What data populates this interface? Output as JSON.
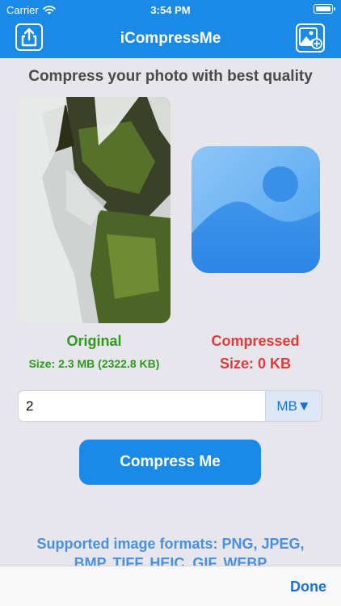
{
  "status": {
    "carrier": "Carrier",
    "time": "3:54 PM"
  },
  "nav": {
    "title": "iCompressMe",
    "left_icon": "share-icon",
    "right_icon": "add-photo-icon"
  },
  "headline": "Compress your photo with best quality",
  "original": {
    "label": "Original",
    "size": "Size: 2.3 MB (2322.8 KB)"
  },
  "compressed": {
    "label": "Compressed",
    "size": "Size: 0 KB"
  },
  "target_size": {
    "value": "2",
    "unit": "MB▼"
  },
  "compress_button": "Compress Me",
  "formats": "Supported image formats: PNG, JPEG, BMP, TIFF, HEIC, GIF, WEBP",
  "toolbar": {
    "done": "Done"
  },
  "colors": {
    "brand_blue": "#1a8ae6",
    "original_green": "#2e9a1c",
    "compressed_red": "#e23a3a",
    "link_blue": "#1a6fd8"
  }
}
